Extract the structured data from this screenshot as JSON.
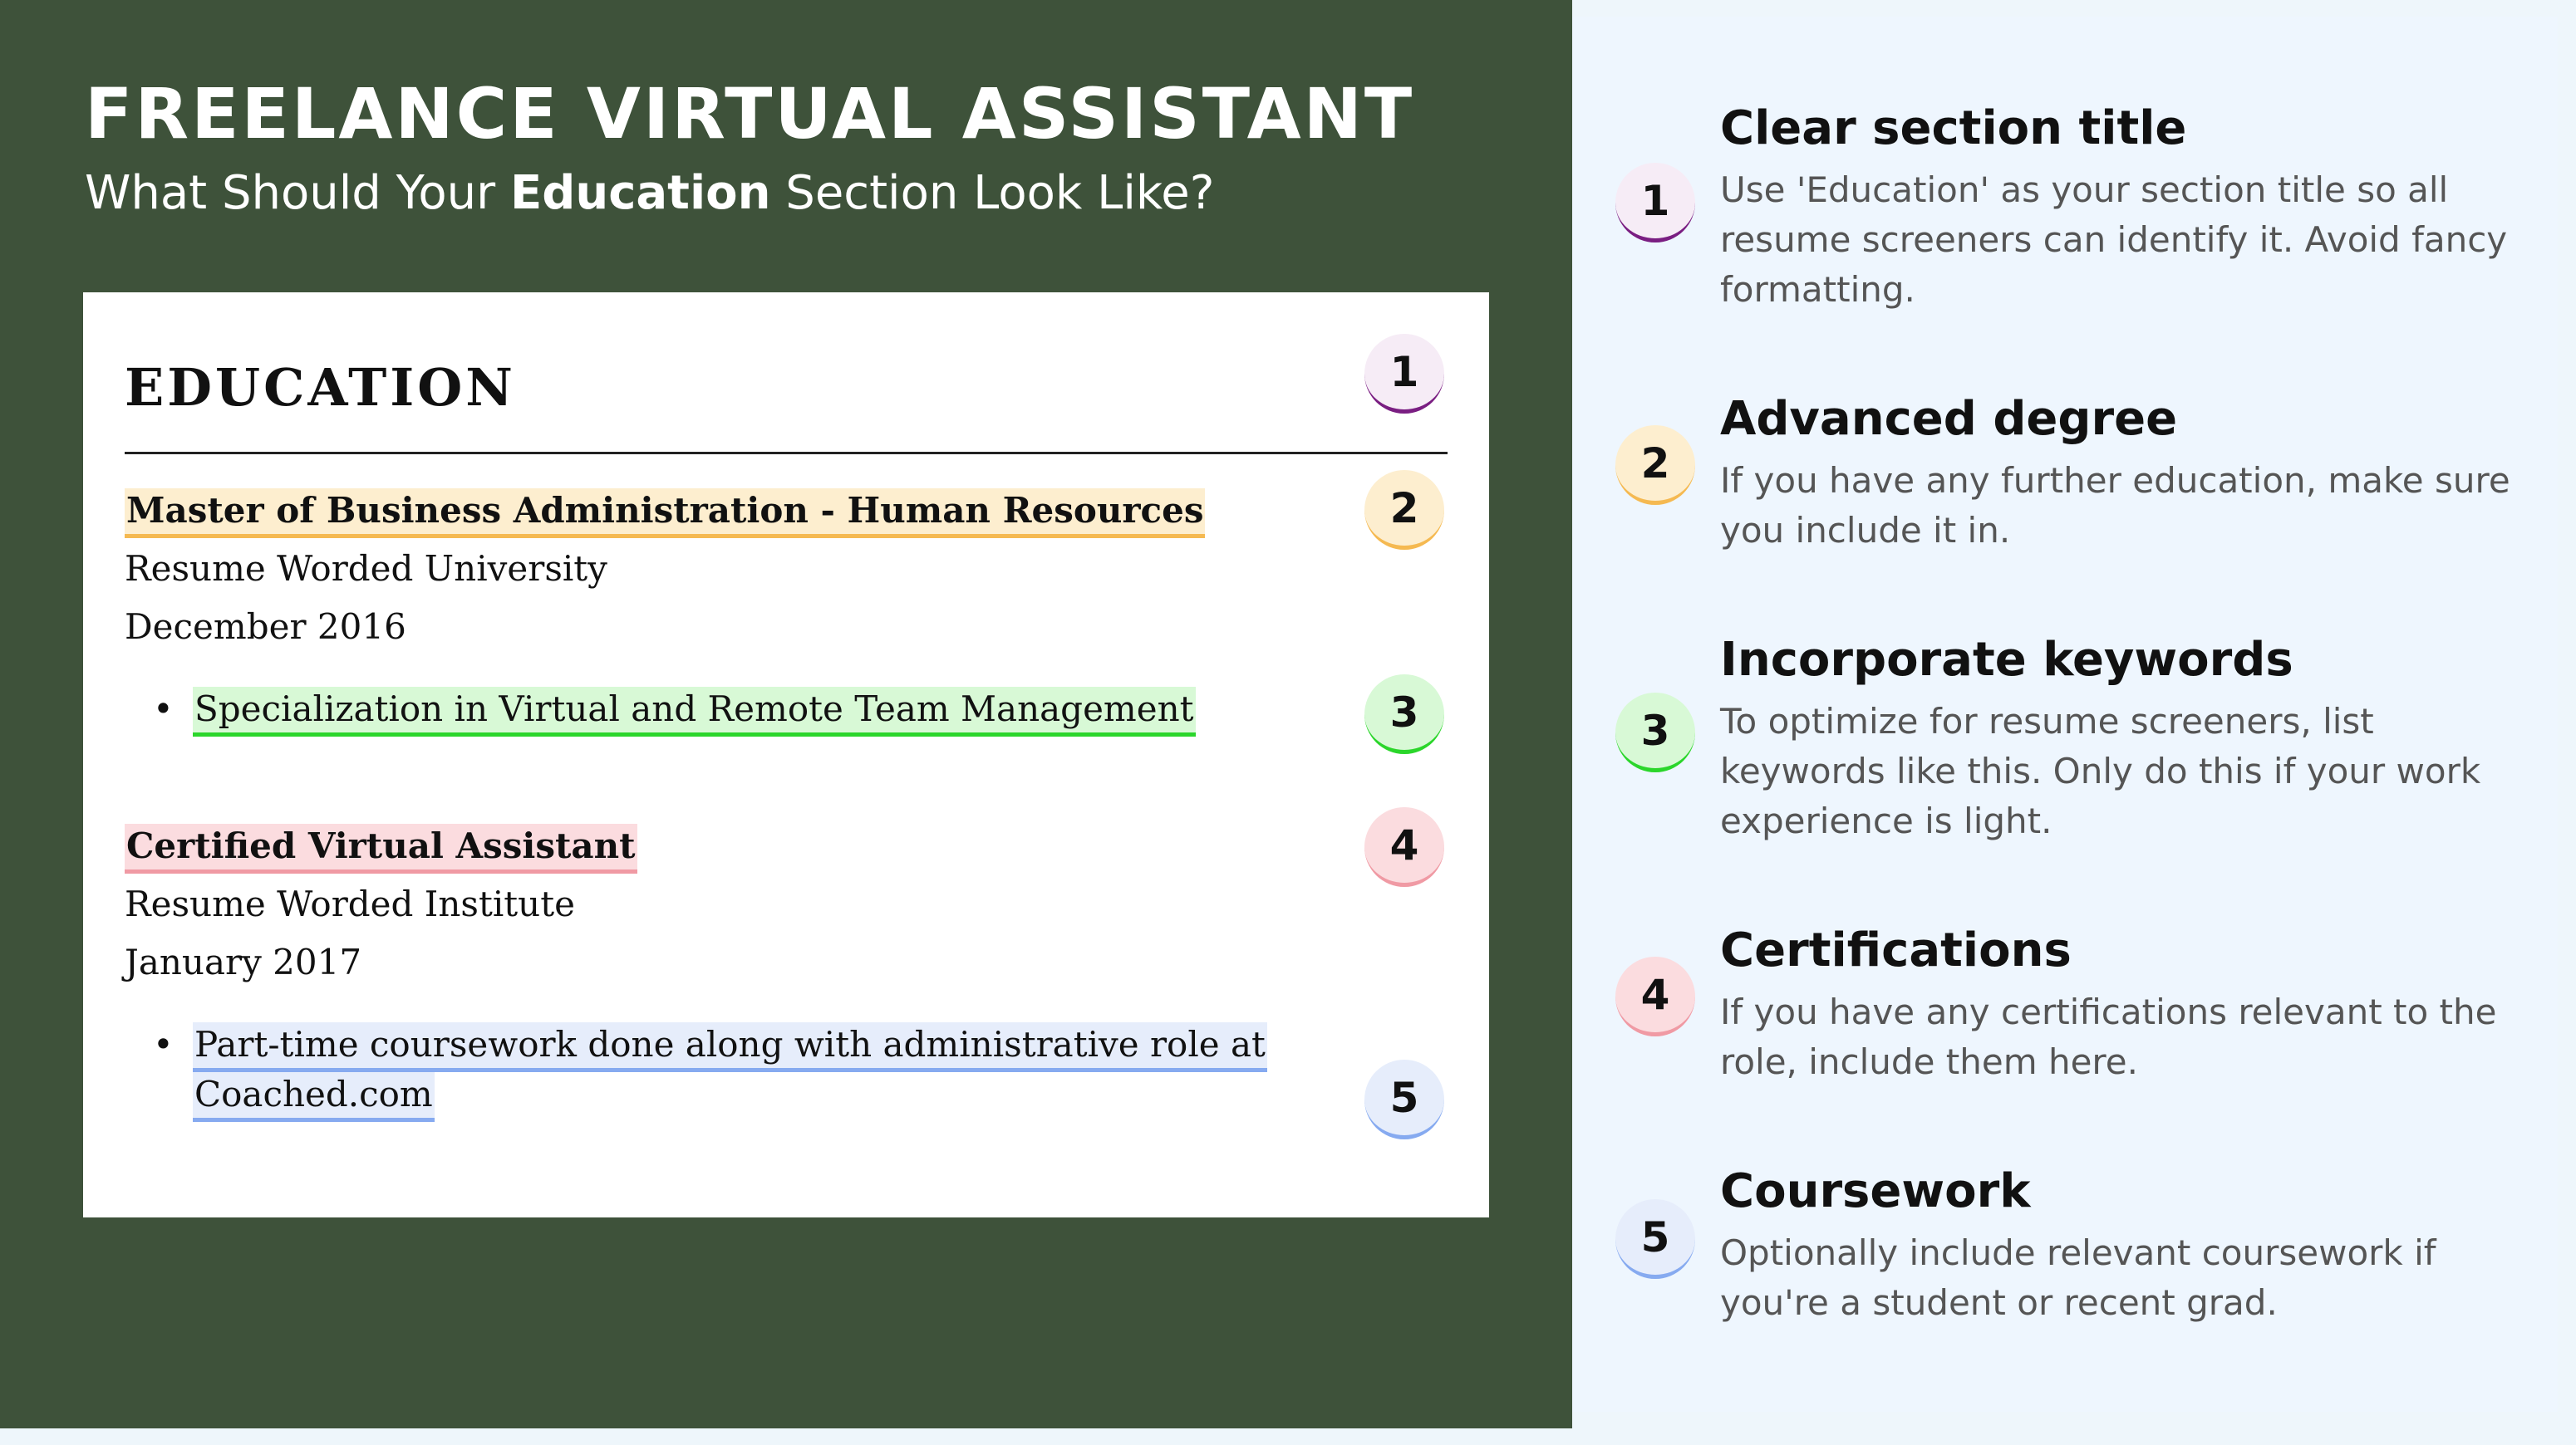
{
  "header": {
    "title": "FREELANCE VIRTUAL ASSISTANT",
    "subtitle_pre": "What Should Your ",
    "subtitle_bold": "Education",
    "subtitle_post": " Section Look Like?"
  },
  "resume": {
    "section_title": "EDUCATION",
    "entries": [
      {
        "degree": "Master of Business Administration - Human Resources",
        "school": "Resume Worded University",
        "date": "December 2016",
        "bullet_line1": "Specialization in Virtual and Remote Team Management"
      },
      {
        "degree": "Certified Virtual Assistant",
        "school": "Resume Worded Institute",
        "date": "January 2017",
        "bullet_line1": "Part-time coursework done along with administrative role at",
        "bullet_line2": "Coached.com"
      }
    ]
  },
  "badges": [
    "1",
    "2",
    "3",
    "4",
    "5"
  ],
  "tips": [
    {
      "number": "1",
      "title": "Clear section title",
      "lines": [
        "Use 'Education' as your section title so all",
        "resume screeners can identify it. Avoid fancy",
        "formatting."
      ]
    },
    {
      "number": "2",
      "title": "Advanced degree",
      "lines": [
        "If you have any further education, make sure",
        "you include it in."
      ]
    },
    {
      "number": "3",
      "title": "Incorporate keywords",
      "lines": [
        "To optimize for resume screeners, list",
        "keywords like this. Only do this if your work",
        "experience is light."
      ]
    },
    {
      "number": "4",
      "title": "Certifications",
      "lines": [
        "If you have any certifications relevant to the",
        "role, include them here."
      ]
    },
    {
      "number": "5",
      "title": "Coursework",
      "lines": [
        "Optionally include relevant coursework if",
        "you're a student or recent grad."
      ]
    }
  ],
  "colors": {
    "background_green": "#3e523a",
    "panel_light": "#eef6fe",
    "badge1": "#7a1e82",
    "badge2": "#f5b951",
    "badge3": "#2bd62b",
    "badge4": "#f09aa4",
    "badge5": "#86aaf0"
  }
}
